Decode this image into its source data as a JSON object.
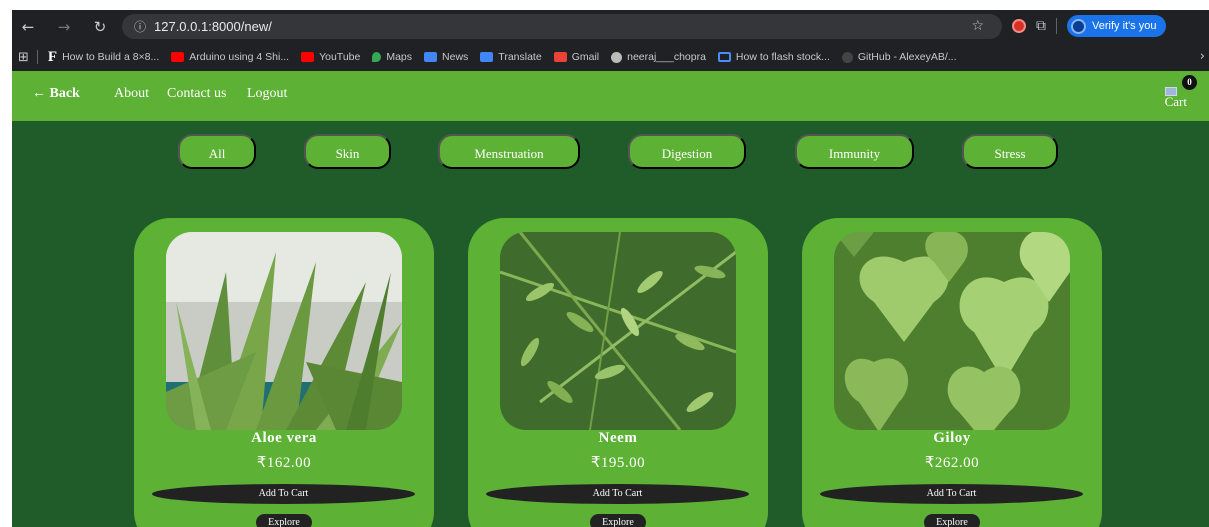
{
  "browser": {
    "url": "127.0.0.1:8000/new/",
    "verify_label": "Verify it's you",
    "bookmarks": [
      {
        "label": "How to Build a 8×8...",
        "color": "#ffffff"
      },
      {
        "label": "Arduino using 4 Shi...",
        "color": "#ff0000"
      },
      {
        "label": "YouTube",
        "color": "#ff0000"
      },
      {
        "label": "Maps",
        "color": "#34a853"
      },
      {
        "label": "News",
        "color": "#4285f4"
      },
      {
        "label": "Translate",
        "color": "#4285f4"
      },
      {
        "label": "Gmail",
        "color": "#ea4335"
      },
      {
        "label": "neeraj___chopra",
        "color": "#bbbbbb"
      },
      {
        "label": "How to flash stock...",
        "color": "#4a8df8"
      },
      {
        "label": "GitHub - AlexeyAB/...",
        "color": "#444444"
      }
    ]
  },
  "nav": {
    "back_label": "← Back",
    "about_label": "About",
    "contact_label": "Contact us",
    "logout_label": "Logout",
    "cart_alt": "Cart",
    "cart_count": "0"
  },
  "filters": [
    "All",
    "Skin",
    "Menstruation",
    "Digestion",
    "Immunity",
    "Stress"
  ],
  "products": [
    {
      "name": "Aloe vera",
      "price": "₹162.00",
      "add_label": "Add To Cart",
      "explore_label": "Explore"
    },
    {
      "name": "Neem",
      "price": "₹195.00",
      "add_label": "Add To Cart",
      "explore_label": "Explore"
    },
    {
      "name": "Giloy",
      "price": "₹262.00",
      "add_label": "Add To Cart",
      "explore_label": "Explore"
    }
  ],
  "colors": {
    "page_bg": "#1f5c2a",
    "accent_green": "#5db135",
    "button_dark": "#222222",
    "browser_chrome": "#202124"
  }
}
